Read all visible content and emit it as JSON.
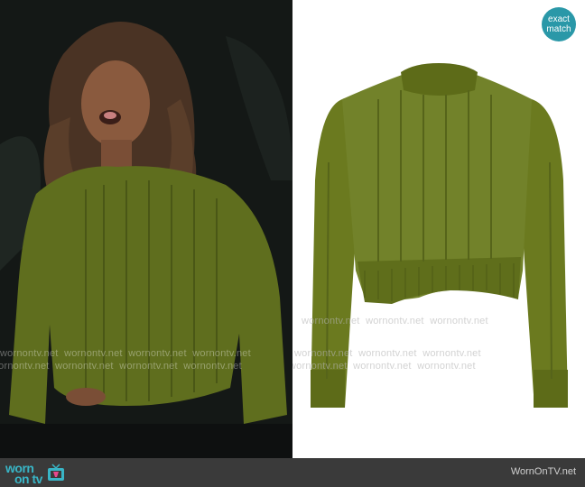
{
  "badge": {
    "line1": "exact",
    "line2": "match"
  },
  "watermark": "wornontv.net",
  "footer": {
    "logo_line1": "worn",
    "logo_line2": "on tv",
    "site": "WornOnTV.net"
  },
  "colors": {
    "badge": "#2a98a8",
    "footer_bg": "#3a3a3a",
    "logo": "#39b5c6",
    "sweater_green": "#6f7d22"
  }
}
